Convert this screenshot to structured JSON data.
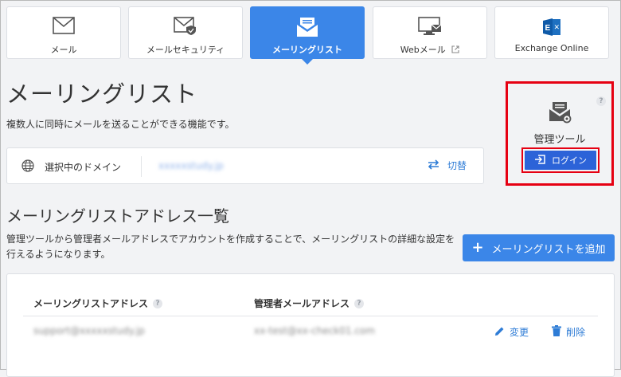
{
  "tabs": [
    {
      "label": "メール",
      "icon": "mail-icon",
      "active": false
    },
    {
      "label": "メールセキュリティ",
      "icon": "mail-security-icon",
      "active": false
    },
    {
      "label": "メーリングリスト",
      "icon": "mailing-list-icon",
      "active": true
    },
    {
      "label": "Webメール",
      "icon": "webmail-icon",
      "active": false,
      "external": true
    },
    {
      "label": "Exchange Online",
      "icon": "exchange-icon",
      "active": false
    }
  ],
  "page": {
    "title": "メーリングリスト",
    "description": "複数人に同時にメールを送ることができる機能です。"
  },
  "domain": {
    "label": "選択中のドメイン",
    "value": "xxxxxstudy.jp",
    "switch_label": "切替"
  },
  "admin_tool": {
    "label": "管理ツール",
    "login_label": "ログイン",
    "help": "?"
  },
  "list_section": {
    "title": "メーリングリストアドレス一覧",
    "description": "管理ツールから管理者メールアドレスでアカウントを作成することで、メーリングリストの詳細な設定を行えるようになります。",
    "add_button": "メーリングリストを追加"
  },
  "table": {
    "headers": [
      "メーリングリストアドレス",
      "管理者メールアドレス"
    ],
    "rows": [
      {
        "address": "support@xxxxxstudy.jp",
        "admin": "xx-test@xx-check01.com",
        "edit": "変更",
        "delete": "削除"
      }
    ]
  },
  "colors": {
    "accent": "#3b86e8",
    "highlight": "#e60012",
    "login": "#2c63d8",
    "link": "#2e7cd6"
  }
}
